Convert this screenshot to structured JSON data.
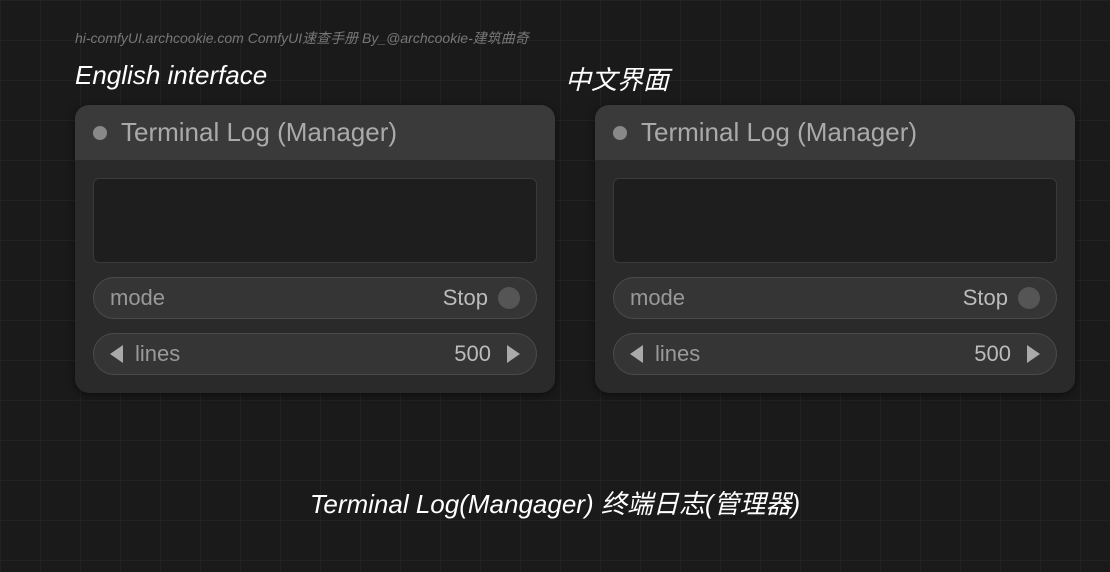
{
  "watermark": "hi-comfyUI.archcookie.com ComfyUI速查手册 By_@archcookie-建筑曲奇",
  "labels": {
    "english": "English interface",
    "chinese": "中文界面"
  },
  "node_english": {
    "title": "Terminal Log (Manager)",
    "mode_label": "mode",
    "mode_value": "Stop",
    "lines_label": "lines",
    "lines_value": "500"
  },
  "node_chinese": {
    "title": "Terminal Log (Manager)",
    "mode_label": "mode",
    "mode_value": "Stop",
    "lines_label": "lines",
    "lines_value": "500"
  },
  "caption": "Terminal Log(Mangager) 终端日志(管理器)"
}
